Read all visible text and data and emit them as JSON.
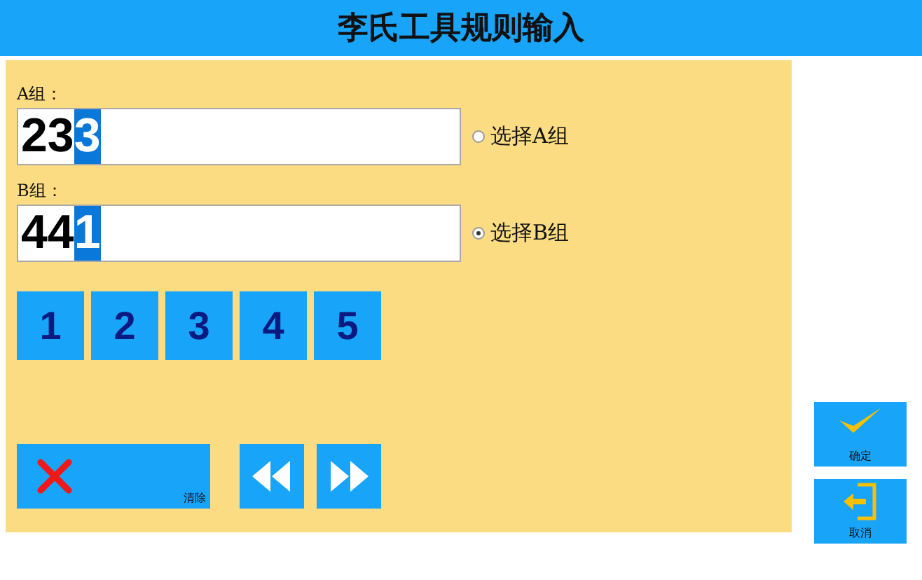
{
  "header": {
    "title": "李氏工具规则输入"
  },
  "groups": [
    {
      "label": "A组：",
      "value": "23",
      "selection": "3",
      "option": "选择A组",
      "selected": false
    },
    {
      "label": "B组：",
      "value": "44",
      "selection": "1",
      "option": "选择B组",
      "selected": true
    }
  ],
  "keypad": [
    "1",
    "2",
    "3",
    "4",
    "5"
  ],
  "actions": [
    {
      "kind": "clear",
      "label": "清除"
    },
    {
      "kind": "back"
    },
    {
      "kind": "forward"
    }
  ],
  "side_buttons": [
    {
      "kind": "confirm",
      "label": "确定"
    },
    {
      "kind": "cancel",
      "label": "取消"
    }
  ]
}
